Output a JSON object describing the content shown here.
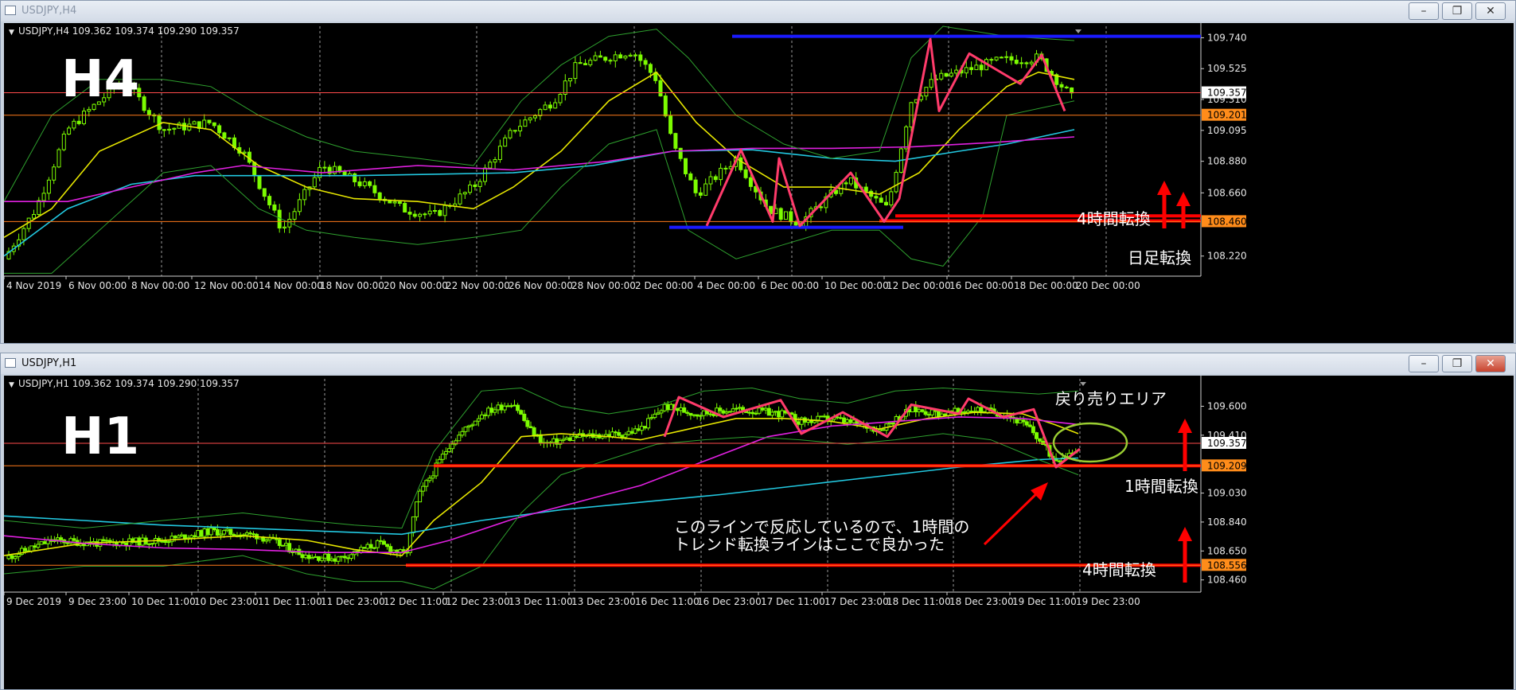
{
  "windows": [
    {
      "title": "USDJPY,H4",
      "title_dim": true,
      "info": "USDJPY,H4  109.362 109.374 109.290 109.357",
      "big_label": "H4",
      "price_axis": [
        {
          "price": 109.74,
          "label": "109.740"
        },
        {
          "price": 109.525,
          "label": "109.525"
        },
        {
          "price": 109.31,
          "label": "109.310"
        },
        {
          "price": 109.095,
          "label": "109.095"
        },
        {
          "price": 108.88,
          "label": "108.880"
        },
        {
          "price": 108.66,
          "label": "108.660"
        },
        {
          "price": 108.22,
          "label": "108.220"
        }
      ],
      "price_tags": [
        {
          "price": 109.357,
          "label": "109.357",
          "style": "current"
        },
        {
          "price": 109.201,
          "label": "109.201",
          "style": "orange"
        },
        {
          "price": 108.46,
          "label": "108.460",
          "style": "orange"
        }
      ],
      "time_axis": [
        "4 Nov 2019",
        "6 Nov 00:00",
        "8 Nov 00:00",
        "12 Nov 00:00",
        "14 Nov 00:00",
        "18 Nov 00:00",
        "20 Nov 00:00",
        "22 Nov 00:00",
        "26 Nov 00:00",
        "28 Nov 00:00",
        "2 Dec 00:00",
        "4 Dec 00:00",
        "6 Dec 00:00",
        "10 Dec 00:00",
        "12 Dec 00:00",
        "16 Dec 00:00",
        "18 Dec 00:00",
        "20 Dec 00:00"
      ],
      "annotations": [
        {
          "text": "4時間転換"
        },
        {
          "text": "日足転換"
        }
      ]
    },
    {
      "title": "USDJPY,H1",
      "title_dim": false,
      "info": "USDJPY,H1  109.362 109.374 109.290 109.357",
      "big_label": "H1",
      "price_axis": [
        {
          "price": 109.6,
          "label": "109.600"
        },
        {
          "price": 109.41,
          "label": "109.410"
        },
        {
          "price": 109.03,
          "label": "109.030"
        },
        {
          "price": 108.84,
          "label": "108.840"
        },
        {
          "price": 108.65,
          "label": "108.650"
        },
        {
          "price": 108.46,
          "label": "108.460"
        }
      ],
      "price_tags": [
        {
          "price": 109.357,
          "label": "109.357",
          "style": "current"
        },
        {
          "price": 109.209,
          "label": "109.209",
          "style": "orange"
        },
        {
          "price": 108.556,
          "label": "108.556",
          "style": "orange"
        }
      ],
      "time_axis": [
        "9 Dec 2019",
        "9 Dec 23:00",
        "10 Dec 11:00",
        "10 Dec 23:00",
        "11 Dec 11:00",
        "11 Dec 23:00",
        "12 Dec 11:00",
        "12 Dec 23:00",
        "13 Dec 11:00",
        "13 Dec 23:00",
        "16 Dec 11:00",
        "16 Dec 23:00",
        "17 Dec 11:00",
        "17 Dec 23:00",
        "18 Dec 11:00",
        "18 Dec 23:00",
        "19 Dec 11:00",
        "19 Dec 23:00"
      ],
      "annotations": [
        {
          "text": "戻り売りエリア"
        },
        {
          "text": "1時間転換"
        },
        {
          "text": "このラインで反応しているので、1時間の"
        },
        {
          "text": "トレンド転換ラインはここで良かった"
        },
        {
          "text": "4時間転換"
        }
      ]
    }
  ],
  "colors": {
    "background": "#000000",
    "candle": "#7CFC00",
    "ma_yellow": "#e6e600",
    "ma_cyan": "#22c8e0",
    "ma_magenta": "#e020e0",
    "bollinger": "#2ea02e",
    "zigzag": "#ff3b6b",
    "level_blue": "#1a1aff",
    "level_red": "#ff0000",
    "orange_line": "#ff7a1a",
    "ellipse": "#9acd32"
  },
  "chart_data": [
    {
      "type": "candlestick",
      "symbol": "USDJPY",
      "timeframe": "H4",
      "ylim": [
        108.08,
        109.82
      ],
      "grid": true,
      "levels": [
        {
          "price": 109.75,
          "color": "blue"
        },
        {
          "price": 108.42,
          "color": "blue"
        },
        {
          "price": 108.5,
          "color": "red",
          "label": "4時間転換"
        },
        {
          "price": 108.465,
          "color": "red",
          "label": "日足転換"
        }
      ],
      "zigzag_prices": [
        108.43,
        108.96,
        108.46,
        108.9,
        108.43,
        108.8,
        108.46,
        108.62,
        109.73,
        109.23,
        109.63,
        109.42,
        109.62,
        109.23
      ]
    },
    {
      "type": "candlestick",
      "symbol": "USDJPY",
      "timeframe": "H1",
      "ylim": [
        108.38,
        109.78
      ],
      "grid": true,
      "levels": [
        {
          "price": 109.209,
          "color": "red",
          "label": "1時間転換"
        },
        {
          "price": 108.556,
          "color": "red",
          "label": "4時間転換"
        }
      ],
      "zigzag_prices": [
        109.4,
        109.66,
        109.53,
        109.64,
        109.42,
        109.56,
        109.4,
        109.61,
        109.55,
        109.65,
        109.53,
        109.58,
        109.2,
        109.32
      ]
    }
  ]
}
